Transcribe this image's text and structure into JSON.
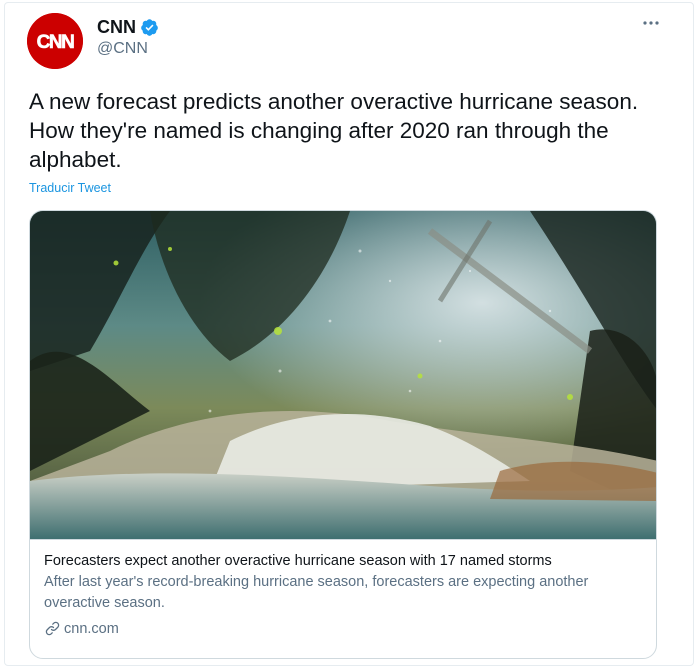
{
  "account": {
    "avatar_logo_text": "CNN",
    "display_name": "CNN",
    "handle": "@CNN",
    "verified_icon": "verified-badge-icon"
  },
  "menu": {
    "more_icon": "ellipsis-icon"
  },
  "tweet": {
    "text": "A new forecast predicts another overactive hurricane season. How they're named is changing after 2020 ran through the alphabet.",
    "translate_label": "Traducir Tweet"
  },
  "card": {
    "title": "Forecasters expect another overactive hurricane season with 17 named storms",
    "description": "After last year's record-breaking hurricane season, forecasters are expecting another overactive season.",
    "domain": "cnn.com",
    "domain_icon": "link-icon"
  },
  "colors": {
    "brand_red": "#cc0000",
    "link_blue": "#1b95e0",
    "verified_blue": "#1d9bf0",
    "secondary_text": "#5b7083",
    "border": "#cfd9de"
  }
}
